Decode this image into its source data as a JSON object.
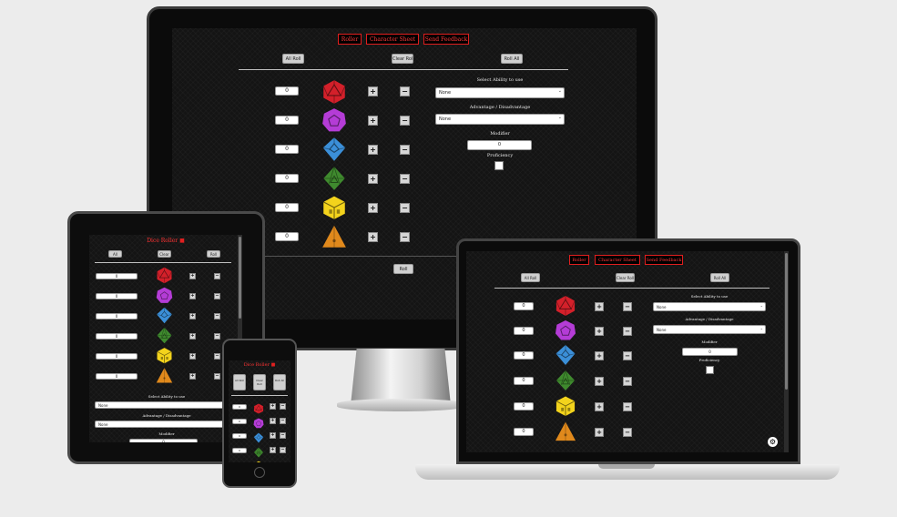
{
  "nav": {
    "roller": "Roller",
    "character_sheet": "Character Sheet",
    "feedback": "Send Feedback"
  },
  "mode_buttons": {
    "all": "All Roll",
    "clear": "Clear Roll",
    "roll": "Roll All"
  },
  "tablet_mode_buttons": {
    "all": "All",
    "clear": "Clear",
    "roll": "Roll"
  },
  "phone_mode_buttons": {
    "all": "All Roll",
    "clear": "Clear Roll",
    "roll": "Roll All"
  },
  "app_title": "Dice Roller",
  "dice": [
    {
      "name": "d20",
      "color": "#d3202a",
      "count": "0"
    },
    {
      "name": "d12",
      "color": "#b43cd6",
      "count": "0"
    },
    {
      "name": "d10",
      "color": "#3b8fd8",
      "count": "0"
    },
    {
      "name": "d8",
      "color": "#3f8a2e",
      "count": "0"
    },
    {
      "name": "d6",
      "color": "#f3d31c",
      "count": "0"
    },
    {
      "name": "d4",
      "color": "#e0891c",
      "count": "0"
    }
  ],
  "plus_label": "+",
  "minus_label": "−",
  "ability": {
    "label": "Select Ability to use",
    "value": "None"
  },
  "advantage": {
    "label": "Advantage / Disadvantage",
    "value": "None"
  },
  "modifier": {
    "label": "Modifier",
    "value": "0"
  },
  "proficiency": {
    "label": "Proficiency"
  },
  "roll_button": "Roll",
  "icons": {
    "settings": "gear-icon"
  }
}
